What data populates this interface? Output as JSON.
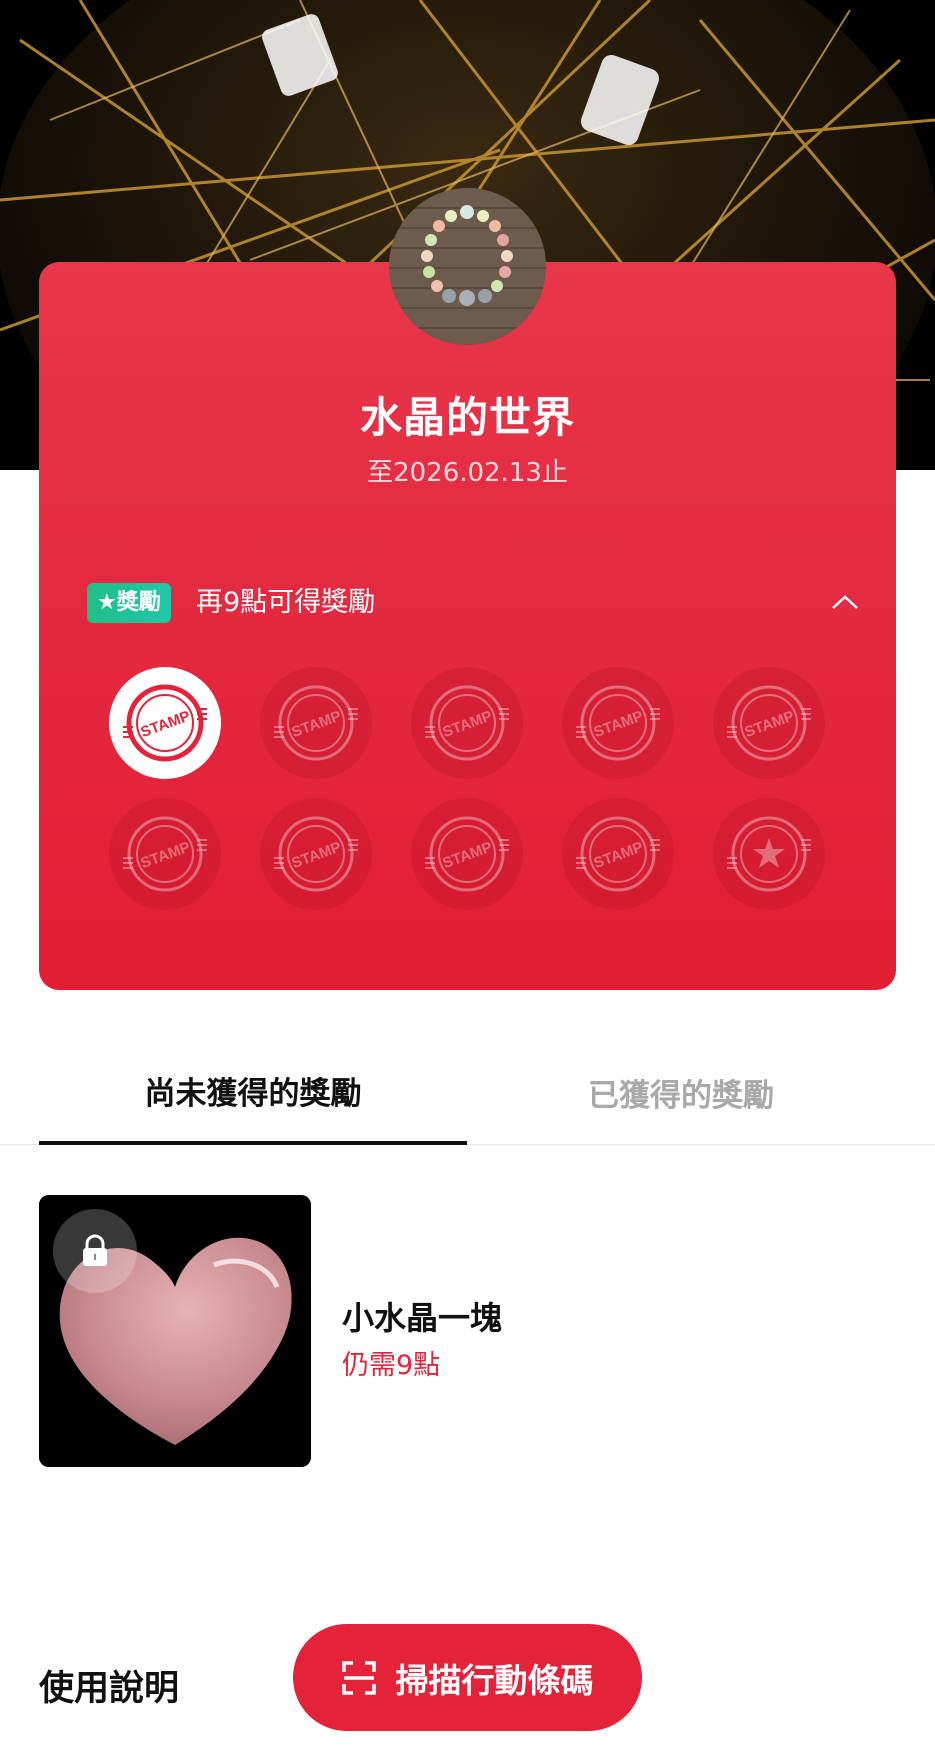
{
  "shop": {
    "name": "水晶的世界",
    "valid_until": "至2026.02.13止"
  },
  "card": {
    "reward_badge": "★獎勵",
    "reward_text": "再9點可得獎勵",
    "stamps_total": 10,
    "stamps_collected": 1,
    "stamp_label": "STAMP"
  },
  "tabs": {
    "unearned": "尚未獲得的獎勵",
    "earned": "已獲得的獎勵"
  },
  "reward_item": {
    "name": "小水晶一塊",
    "remaining": "仍需9點"
  },
  "footer": {
    "usage": "使用說明",
    "scan_button": "掃描行動條碼"
  },
  "colors": {
    "accent_red": "#e4233a",
    "badge_green": "#1fbf87"
  }
}
